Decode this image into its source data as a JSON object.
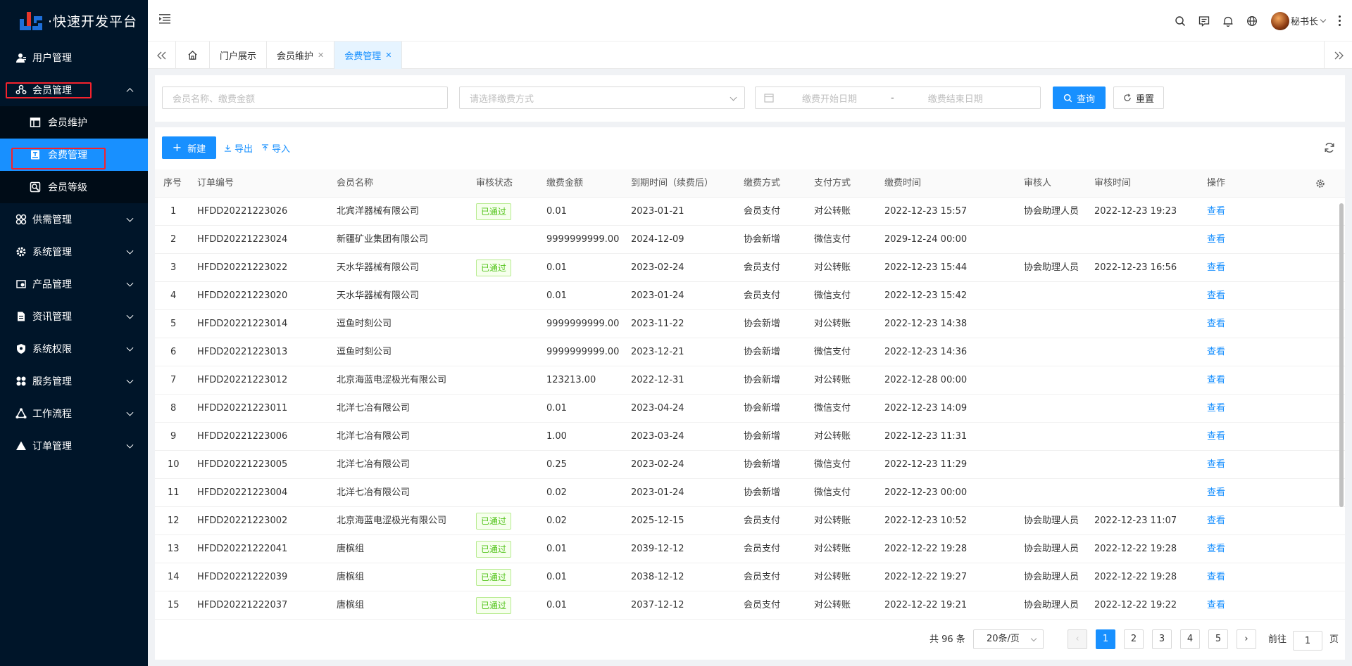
{
  "app": {
    "title": "·快速开发平台"
  },
  "sidebar": {
    "items": [
      {
        "label": "用户管理",
        "icon": "user-icon"
      },
      {
        "label": "会员管理",
        "icon": "members-icon",
        "expanded": true,
        "children": [
          {
            "label": "会员维护",
            "icon": "table-icon"
          },
          {
            "label": "会费管理",
            "icon": "fee-icon",
            "active": true
          },
          {
            "label": "会员等级",
            "icon": "level-icon"
          }
        ]
      },
      {
        "label": "供需管理",
        "icon": "grid-icon"
      },
      {
        "label": "系统管理",
        "icon": "gear-icon"
      },
      {
        "label": "产品管理",
        "icon": "product-icon"
      },
      {
        "label": "资讯管理",
        "icon": "document-icon"
      },
      {
        "label": "系统权限",
        "icon": "shield-icon"
      },
      {
        "label": "服务管理",
        "icon": "service-icon"
      },
      {
        "label": "工作流程",
        "icon": "workflow-icon"
      },
      {
        "label": "订单管理",
        "icon": "triangle-icon"
      }
    ]
  },
  "header": {
    "user_name": "秘书长"
  },
  "tabs": [
    {
      "label": "门户展示",
      "closable": false
    },
    {
      "label": "会员维护",
      "closable": true
    },
    {
      "label": "会费管理",
      "closable": true,
      "active": true
    }
  ],
  "search": {
    "member_placeholder": "会员名称、缴费金额",
    "method_placeholder": "请选择缴费方式",
    "start_date_placeholder": "缴费开始日期",
    "date_separator": "-",
    "end_date_placeholder": "缴费结束日期",
    "query_label": "查询",
    "reset_label": "重置"
  },
  "toolbar": {
    "new_label": "新建",
    "export_label": "导出",
    "import_label": "导入"
  },
  "table": {
    "columns": [
      "序号",
      "订单编号",
      "会员名称",
      "审核状态",
      "缴费金额",
      "到期时间（续费后）",
      "缴费方式",
      "支付方式",
      "缴费时间",
      "审核人",
      "审核时间",
      "操作"
    ],
    "rows": [
      [
        "1",
        "HFDD20221223026",
        "北宾洋器械有限公司",
        "已通过",
        "0.01",
        "2023-01-21",
        "会员支付",
        "对公转账",
        "2022-12-23 15:57",
        "协会助理人员",
        "2022-12-23 19:23",
        "查看"
      ],
      [
        "2",
        "HFDD20221223024",
        "新疆矿业集团有限公司",
        "",
        "9999999999.00",
        "2024-12-09",
        "协会新增",
        "微信支付",
        "2029-12-24 00:00",
        "",
        "",
        "查看"
      ],
      [
        "3",
        "HFDD20221223022",
        "天水华器械有限公司",
        "已通过",
        "0.01",
        "2023-02-24",
        "会员支付",
        "对公转账",
        "2022-12-23 15:44",
        "协会助理人员",
        "2022-12-23 16:56",
        "查看"
      ],
      [
        "4",
        "HFDD20221223020",
        "天水华器械有限公司",
        "",
        "0.01",
        "2023-01-24",
        "会员支付",
        "微信支付",
        "2022-12-23 15:42",
        "",
        "",
        "查看"
      ],
      [
        "5",
        "HFDD20221223014",
        "逗鱼时刻公司",
        "",
        "9999999999.00",
        "2023-11-22",
        "协会新增",
        "对公转账",
        "2022-12-23 14:38",
        "",
        "",
        "查看"
      ],
      [
        "6",
        "HFDD20221223013",
        "逗鱼时刻公司",
        "",
        "9999999999.00",
        "2023-12-21",
        "协会新增",
        "微信支付",
        "2022-12-23 14:36",
        "",
        "",
        "查看"
      ],
      [
        "7",
        "HFDD20221223012",
        "北京海蓝电涩极光有限公司",
        "",
        "123213.00",
        "2022-12-31",
        "协会新增",
        "对公转账",
        "2022-12-28 00:00",
        "",
        "",
        "查看"
      ],
      [
        "8",
        "HFDD20221223011",
        "北洋七冶有限公司",
        "",
        "0.01",
        "2023-04-24",
        "协会新增",
        "微信支付",
        "2022-12-23 14:09",
        "",
        "",
        "查看"
      ],
      [
        "9",
        "HFDD20221223006",
        "北洋七冶有限公司",
        "",
        "1.00",
        "2023-03-24",
        "协会新增",
        "对公转账",
        "2022-12-23 11:31",
        "",
        "",
        "查看"
      ],
      [
        "10",
        "HFDD20221223005",
        "北洋七冶有限公司",
        "",
        "0.25",
        "2023-02-24",
        "协会新增",
        "微信支付",
        "2022-12-23 11:29",
        "",
        "",
        "查看"
      ],
      [
        "11",
        "HFDD20221223004",
        "北洋七冶有限公司",
        "",
        "0.02",
        "2023-01-24",
        "协会新增",
        "微信支付",
        "2022-12-23 00:00",
        "",
        "",
        "查看"
      ],
      [
        "12",
        "HFDD20221223002",
        "北京海蓝电涩极光有限公司",
        "已通过",
        "0.02",
        "2025-12-15",
        "会员支付",
        "对公转账",
        "2022-12-23 10:52",
        "协会助理人员",
        "2022-12-23 11:07",
        "查看"
      ],
      [
        "13",
        "HFDD20221222041",
        "唐槟组",
        "已通过",
        "0.01",
        "2039-12-12",
        "会员支付",
        "对公转账",
        "2022-12-22 19:28",
        "协会助理人员",
        "2022-12-22 19:28",
        "查看"
      ],
      [
        "14",
        "HFDD20221222039",
        "唐槟组",
        "已通过",
        "0.01",
        "2038-12-12",
        "会员支付",
        "对公转账",
        "2022-12-22 19:27",
        "协会助理人员",
        "2022-12-22 19:28",
        "查看"
      ],
      [
        "15",
        "HFDD20221222037",
        "唐槟组",
        "已通过",
        "0.01",
        "2037-12-12",
        "会员支付",
        "对公转账",
        "2022-12-22 19:21",
        "协会助理人员",
        "2022-12-22 19:22",
        "查看"
      ]
    ]
  },
  "pagination": {
    "total": "共 96 条",
    "page_size": "20条/页",
    "pages": [
      "1",
      "2",
      "3",
      "4",
      "5"
    ],
    "current": "1",
    "goto_label": "前往",
    "goto_value": "1",
    "page_suffix": "页"
  },
  "colors": {
    "primary": "#1890ff",
    "sidebar": "#001529",
    "success": "#52c41a",
    "highlight": "#f5222d"
  }
}
